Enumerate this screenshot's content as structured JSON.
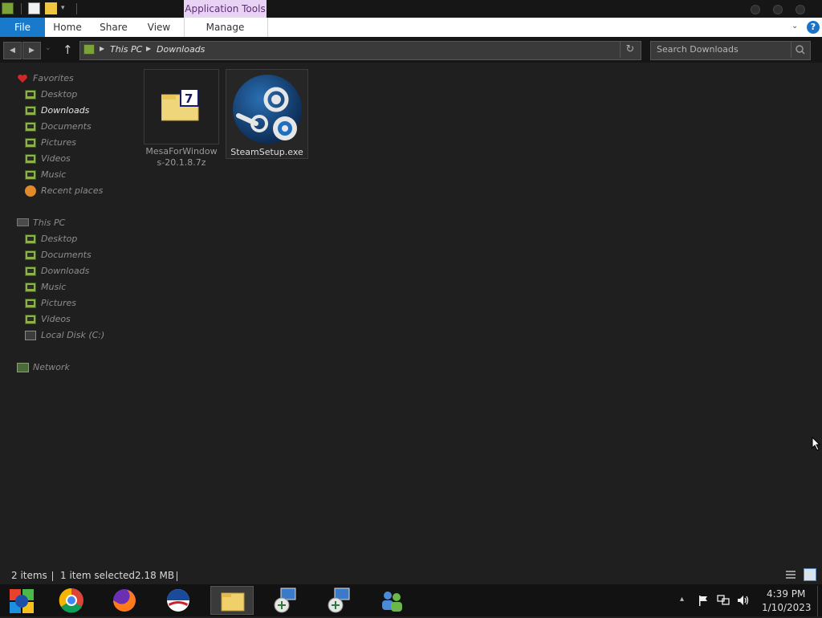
{
  "ribbon": {
    "contextual_group": "Application Tools",
    "tabs": [
      "File",
      "Home",
      "Share",
      "View",
      "Manage"
    ]
  },
  "address": {
    "crumbs": [
      "This PC",
      "Downloads"
    ]
  },
  "search": {
    "placeholder": "Search Downloads"
  },
  "sidebar": {
    "favorites": {
      "label": "Favorites",
      "items": [
        "Desktop",
        "Downloads",
        "Documents",
        "Pictures",
        "Videos",
        "Music",
        "Recent places"
      ]
    },
    "this_pc": {
      "label": "This PC",
      "items": [
        "Desktop",
        "Documents",
        "Downloads",
        "Music",
        "Pictures",
        "Videos",
        "Local Disk (C:)"
      ]
    },
    "network": {
      "label": "Network"
    }
  },
  "files": [
    {
      "name_line1": "MesaForWindow",
      "name_line2": "s-20.1.8.7z",
      "icon": "7z-archive-icon"
    },
    {
      "name": "SteamSetup.exe",
      "icon": "steam-icon",
      "selected": true
    }
  ],
  "status": {
    "items": "2 items",
    "selected": "1 item selected",
    "size": "2.18 MB"
  },
  "taskbar": {
    "apps": [
      "start-icon",
      "chrome-icon",
      "firefox-icon",
      "obama-logo-icon",
      "file-explorer-icon",
      "network-setup-icon",
      "network-setup-icon",
      "users-icon"
    ]
  },
  "clock": {
    "time": "4:39 PM",
    "date": "1/10/2023"
  },
  "colors": {
    "accent": "#1979ca",
    "contextual": "#e9d3f4",
    "background": "#1f1f1f"
  }
}
